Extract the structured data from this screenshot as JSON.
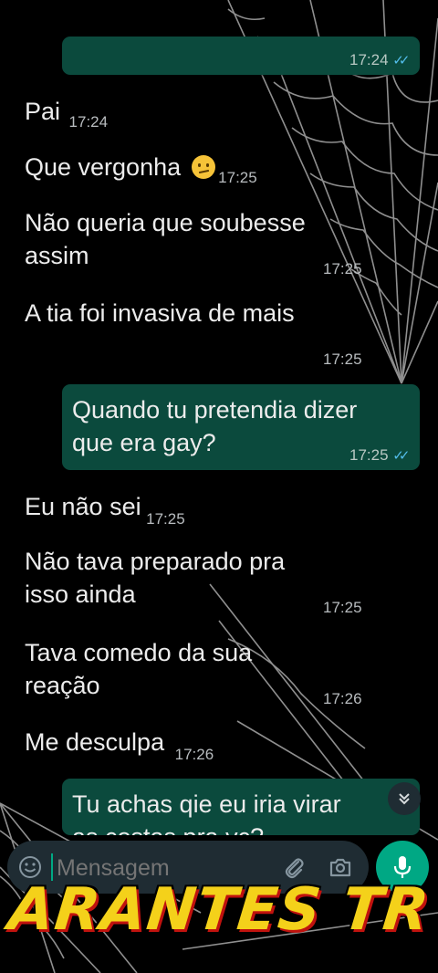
{
  "messages_in": [
    {
      "text": "Pai",
      "time": "17:24"
    },
    {
      "text": "Que vergonha",
      "time": "17:25"
    },
    {
      "line1": "Não queria que soubesse",
      "line2": "assim",
      "time": "17:25"
    },
    {
      "text": "A tia foi invasiva de mais",
      "time": "17:25"
    },
    {
      "text": "Eu não sei",
      "time": "17:25"
    },
    {
      "line1": "Não tava preparado pra",
      "line2": "isso ainda",
      "time": "17:25"
    },
    {
      "line1": "Tava comedo da sua",
      "line2": "reação",
      "time": "17:26"
    },
    {
      "text": "Me desculpa",
      "time": "17:26"
    }
  ],
  "messages_out": [
    {
      "time": "17:24"
    },
    {
      "line1": "Quando tu pretendia dizer",
      "line2": "que era gay?",
      "time": "17:25"
    },
    {
      "line1": "Tu achas qie eu iria virar",
      "line2": "as costas pra vc?"
    }
  ],
  "input": {
    "placeholder": "Mensagem"
  },
  "watermark": "ARANTES TR",
  "icons": [
    "emoji-icon",
    "attach-icon",
    "camera-icon",
    "mic-icon",
    "chevron-down-icon",
    "double-check-icon"
  ],
  "colors": {
    "outgoing_bubble": "#0b4a3d",
    "accent": "#00a884",
    "ticks": "#53bdeb",
    "watermark": "#f4d11a"
  }
}
